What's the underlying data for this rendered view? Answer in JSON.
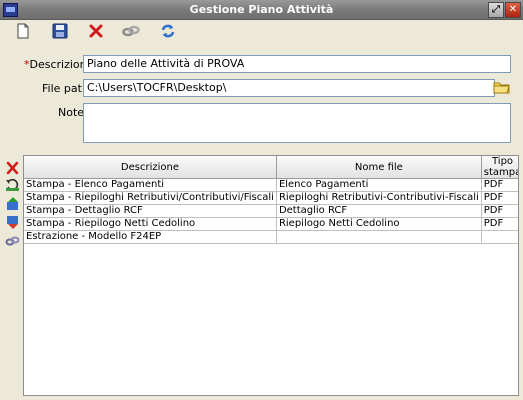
{
  "window": {
    "title": "Gestione Piano Attività"
  },
  "toolbar": {
    "icons": [
      "new-document-icon",
      "save-icon",
      "delete-icon",
      "link-icon",
      "refresh-icon"
    ]
  },
  "form": {
    "descrizione_required_mark": "*",
    "descrizione_label": "Descrizione",
    "descrizione_value": "Piano delle Attività di PROVA",
    "filepath_label": "File path",
    "filepath_value": "C:\\Users\\TOCFR\\Desktop\\",
    "note_label": "Note",
    "note_value": ""
  },
  "side_icons": [
    "delete-row-icon",
    "undo-icon",
    "move-up-icon",
    "move-down-icon",
    "link-icon"
  ],
  "table": {
    "headers": [
      "Descrizione",
      "Nome file",
      "Tipo stampa"
    ],
    "rows": [
      [
        "Stampa - Elenco Pagamenti",
        "Elenco Pagamenti",
        "PDF"
      ],
      [
        "Stampa - Riepiloghi Retributivi/Contributivi/Fiscali",
        "Riepiloghi Retributivi-Contributivi-Fiscali",
        "PDF"
      ],
      [
        "Stampa - Dettaglio RCF",
        "Dettaglio RCF",
        "PDF"
      ],
      [
        "Stampa - Riepilogo Netti Cedolino",
        "Riepilogo Netti Cedolino",
        "PDF"
      ],
      [
        "Estrazione - Modello F24EP",
        "",
        ""
      ]
    ]
  }
}
